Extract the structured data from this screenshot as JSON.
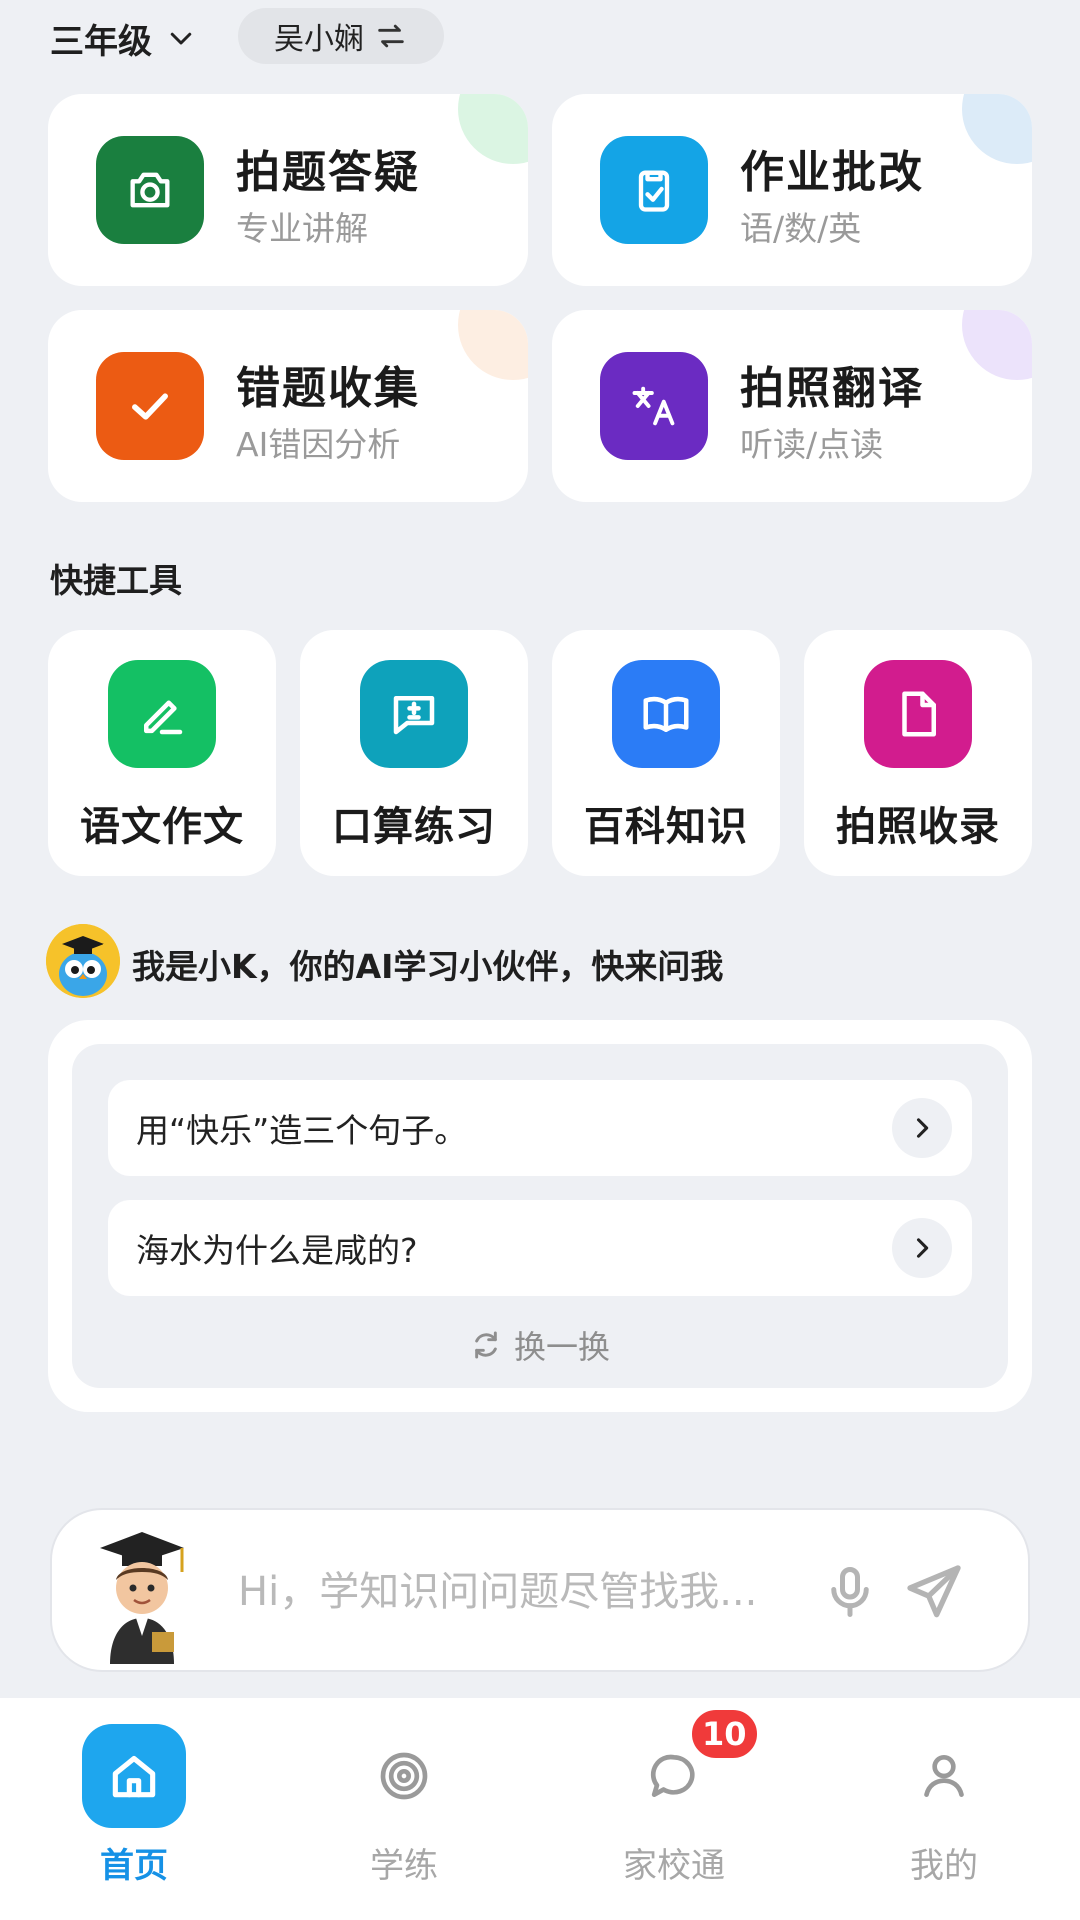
{
  "header": {
    "grade": "三年级",
    "user_name": "吴小娴"
  },
  "features": [
    {
      "title": "拍题答疑",
      "subtitle": "专业讲解",
      "icon": "camera-icon",
      "color": "#1a7f3f"
    },
    {
      "title": "作业批改",
      "subtitle": "语/数/英",
      "icon": "clipboard-check-icon",
      "color": "#14a4e6"
    },
    {
      "title": "错题收集",
      "subtitle": "AI错因分析",
      "icon": "check-icon",
      "color": "#ec5b13"
    },
    {
      "title": "拍照翻译",
      "subtitle": "听读/点读",
      "icon": "translate-icon",
      "color": "#6b2bc2"
    }
  ],
  "quick_tools": {
    "title": "快捷工具",
    "items": [
      {
        "label": "语文作文",
        "icon": "pencil-icon",
        "color": "#14c064"
      },
      {
        "label": "口算练习",
        "icon": "calc-chat-icon",
        "color": "#0ea2bb"
      },
      {
        "label": "百科知识",
        "icon": "book-icon",
        "color": "#2b7cf6"
      },
      {
        "label": "拍照收录",
        "icon": "document-icon",
        "color": "#d21c8e"
      }
    ]
  },
  "assistant": {
    "intro": "我是小K，你的AI学习小伙伴，快来问我",
    "suggestions": [
      "用“快乐”造三个句子。",
      "海水为什么是咸的?"
    ],
    "refresh_label": "换一换"
  },
  "input": {
    "placeholder": "Hi，学知识问问题尽管找我..."
  },
  "nav": [
    {
      "label": "首页",
      "icon": "home-icon",
      "active": true
    },
    {
      "label": "学练",
      "icon": "target-icon"
    },
    {
      "label": "家校通",
      "icon": "chat-icon",
      "badge": "10"
    },
    {
      "label": "我的",
      "icon": "user-icon"
    }
  ]
}
